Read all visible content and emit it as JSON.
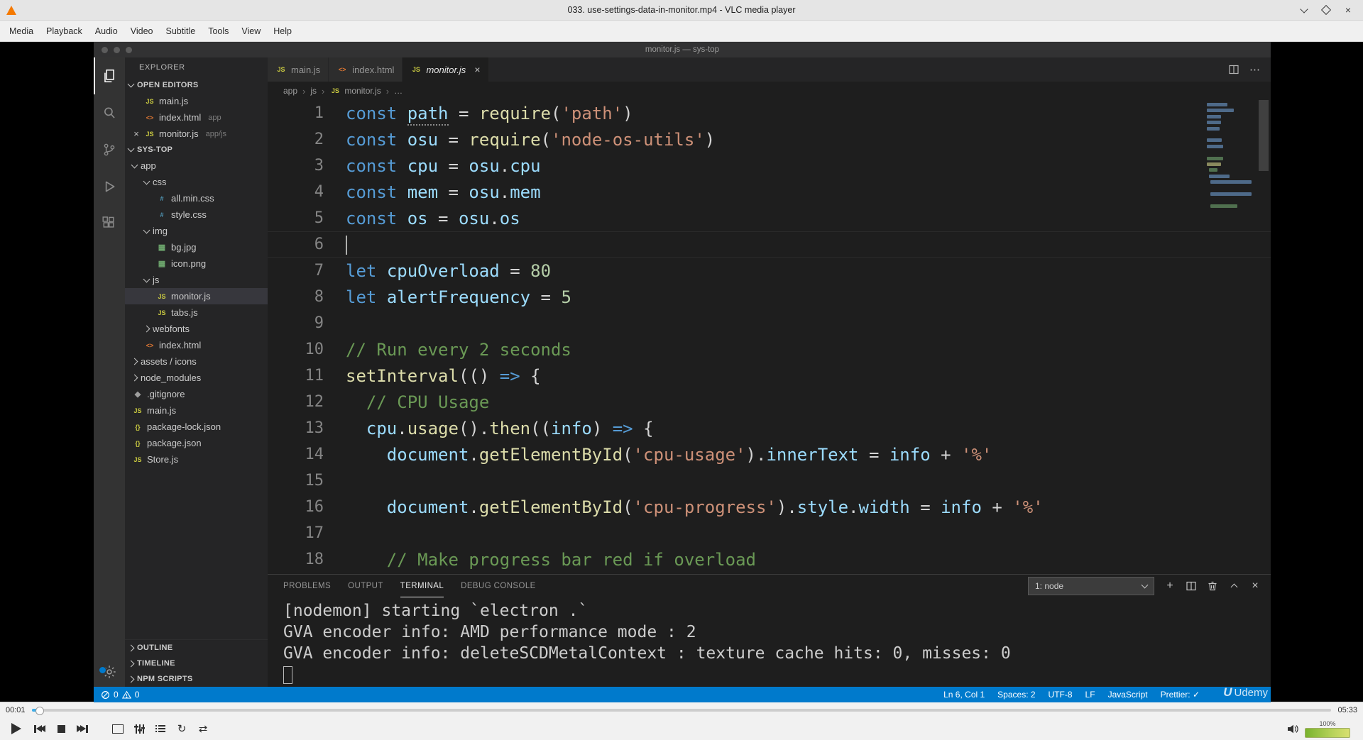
{
  "vlc": {
    "titlebar": {
      "title": "033. use-settings-data-in-monitor.mp4 - VLC media player",
      "buttons": [
        "minimize",
        "maximize",
        "close"
      ]
    },
    "menu": [
      "Media",
      "Playback",
      "Audio",
      "Video",
      "Subtitle",
      "Tools",
      "View",
      "Help"
    ],
    "seek": {
      "elapsed": "00:01",
      "duration": "05:33",
      "progress_percent": 0.4
    },
    "volume": {
      "level_label": "100%"
    }
  },
  "recording": {
    "window_title": "monitor.js — sys-top"
  },
  "vscode": {
    "activity_bar": {
      "items": [
        "explorer",
        "search",
        "source-control",
        "run-and-debug",
        "extensions"
      ],
      "active": "explorer",
      "bottom": "manage"
    },
    "file_icons": {
      "js": {
        "glyph": "JS",
        "color": "#cbcb41"
      },
      "html": {
        "glyph": "<>",
        "color": "#e37933"
      },
      "css": {
        "glyph": "#",
        "color": "#519aba"
      },
      "img": {
        "glyph": "▦",
        "color": "#6ea86e"
      },
      "json": {
        "glyph": "{}",
        "color": "#cbcb41"
      },
      "git": {
        "glyph": "◆",
        "color": "#9e9e9e"
      }
    },
    "explorer": {
      "header": "EXPLORER",
      "open_editors": {
        "label": "OPEN EDITORS",
        "items": [
          {
            "name": "main.js",
            "icon": "js"
          },
          {
            "name": "index.html",
            "icon": "html",
            "hint": "app"
          },
          {
            "name": "monitor.js",
            "icon": "js",
            "hint": "app/js",
            "close": true
          }
        ]
      },
      "project": {
        "label": "SYS-TOP",
        "items": [
          {
            "name": "app",
            "depth": 0,
            "folder": true,
            "expanded": true
          },
          {
            "name": "css",
            "depth": 1,
            "folder": true,
            "expanded": true
          },
          {
            "name": "all.min.css",
            "depth": 2,
            "icon": "css"
          },
          {
            "name": "style.css",
            "depth": 2,
            "icon": "css"
          },
          {
            "name": "img",
            "depth": 1,
            "folder": true,
            "expanded": true
          },
          {
            "name": "bg.jpg",
            "depth": 2,
            "icon": "img"
          },
          {
            "name": "icon.png",
            "depth": 2,
            "icon": "img"
          },
          {
            "name": "js",
            "depth": 1,
            "folder": true,
            "expanded": true
          },
          {
            "name": "monitor.js",
            "depth": 2,
            "icon": "js",
            "selected": true
          },
          {
            "name": "tabs.js",
            "depth": 2,
            "icon": "js"
          },
          {
            "name": "webfonts",
            "depth": 1,
            "folder": true,
            "expanded": false
          },
          {
            "name": "index.html",
            "depth": 1,
            "icon": "html"
          },
          {
            "name": "assets / icons",
            "depth": 0,
            "folder": true,
            "expanded": false
          },
          {
            "name": "node_modules",
            "depth": 0,
            "folder": true,
            "expanded": false
          },
          {
            "name": ".gitignore",
            "depth": 0,
            "icon": "git"
          },
          {
            "name": "main.js",
            "depth": 0,
            "icon": "js"
          },
          {
            "name": "package-lock.json",
            "depth": 0,
            "icon": "json"
          },
          {
            "name": "package.json",
            "depth": 0,
            "icon": "json"
          },
          {
            "name": "Store.js",
            "depth": 0,
            "icon": "js"
          }
        ]
      },
      "bottom_sections": [
        "OUTLINE",
        "TIMELINE",
        "NPM SCRIPTS"
      ]
    },
    "tabs": [
      {
        "label": "main.js",
        "icon": "js"
      },
      {
        "label": "index.html",
        "icon": "html"
      },
      {
        "label": "monitor.js",
        "icon": "js",
        "active": true
      }
    ],
    "breadcrumb": [
      {
        "label": "app"
      },
      {
        "label": "js"
      },
      {
        "label": "monitor.js",
        "icon": "js"
      },
      {
        "label": "…"
      }
    ],
    "code": {
      "lines": [
        {
          "n": 1,
          "tokens": [
            [
              "k",
              "const"
            ],
            [
              "d",
              " "
            ],
            [
              "v dots",
              "path"
            ],
            [
              "d",
              " = "
            ],
            [
              "f",
              "require"
            ],
            [
              "d",
              "("
            ],
            [
              "s",
              "'path'"
            ],
            [
              "d",
              ")"
            ]
          ]
        },
        {
          "n": 2,
          "tokens": [
            [
              "k",
              "const"
            ],
            [
              "d",
              " "
            ],
            [
              "v",
              "osu"
            ],
            [
              "d",
              " = "
            ],
            [
              "f",
              "require"
            ],
            [
              "d",
              "("
            ],
            [
              "s",
              "'node-os-utils'"
            ],
            [
              "d",
              ")"
            ]
          ]
        },
        {
          "n": 3,
          "tokens": [
            [
              "k",
              "const"
            ],
            [
              "d",
              " "
            ],
            [
              "v",
              "cpu"
            ],
            [
              "d",
              " = "
            ],
            [
              "v",
              "osu"
            ],
            [
              "d",
              "."
            ],
            [
              "v",
              "cpu"
            ]
          ]
        },
        {
          "n": 4,
          "tokens": [
            [
              "k",
              "const"
            ],
            [
              "d",
              " "
            ],
            [
              "v",
              "mem"
            ],
            [
              "d",
              " = "
            ],
            [
              "v",
              "osu"
            ],
            [
              "d",
              "."
            ],
            [
              "v",
              "mem"
            ]
          ]
        },
        {
          "n": 5,
          "tokens": [
            [
              "k",
              "const"
            ],
            [
              "d",
              " "
            ],
            [
              "v",
              "os"
            ],
            [
              "d",
              " = "
            ],
            [
              "v",
              "osu"
            ],
            [
              "d",
              "."
            ],
            [
              "v",
              "os"
            ]
          ]
        },
        {
          "n": 6,
          "tokens": [],
          "current": true
        },
        {
          "n": 7,
          "tokens": [
            [
              "k",
              "let"
            ],
            [
              "d",
              " "
            ],
            [
              "v",
              "cpuOverload"
            ],
            [
              "d",
              " = "
            ],
            [
              "n",
              "80"
            ]
          ]
        },
        {
          "n": 8,
          "tokens": [
            [
              "k",
              "let"
            ],
            [
              "d",
              " "
            ],
            [
              "v",
              "alertFrequency"
            ],
            [
              "d",
              " = "
            ],
            [
              "n",
              "5"
            ]
          ]
        },
        {
          "n": 9,
          "tokens": []
        },
        {
          "n": 10,
          "tokens": [
            [
              "c",
              "// Run every 2 seconds"
            ]
          ]
        },
        {
          "n": 11,
          "tokens": [
            [
              "f",
              "setInterval"
            ],
            [
              "d",
              "(() "
            ],
            [
              "a",
              "=>"
            ],
            [
              "d",
              " {"
            ]
          ]
        },
        {
          "n": 12,
          "tokens": [
            [
              "c",
              "  // CPU Usage"
            ]
          ]
        },
        {
          "n": 13,
          "tokens": [
            [
              "d",
              "  "
            ],
            [
              "v",
              "cpu"
            ],
            [
              "d",
              "."
            ],
            [
              "f",
              "usage"
            ],
            [
              "d",
              "()."
            ],
            [
              "f",
              "then"
            ],
            [
              "d",
              "(("
            ],
            [
              "v",
              "info"
            ],
            [
              "d",
              ") "
            ],
            [
              "a",
              "=>"
            ],
            [
              "d",
              " {"
            ]
          ]
        },
        {
          "n": 14,
          "tokens": [
            [
              "d",
              "    "
            ],
            [
              "v",
              "document"
            ],
            [
              "d",
              "."
            ],
            [
              "f",
              "getElementById"
            ],
            [
              "d",
              "("
            ],
            [
              "s",
              "'cpu-usage'"
            ],
            [
              "d",
              ")."
            ],
            [
              "v",
              "innerText"
            ],
            [
              "d",
              " = "
            ],
            [
              "v",
              "info"
            ],
            [
              "d",
              " + "
            ],
            [
              "s",
              "'%'"
            ]
          ]
        },
        {
          "n": 15,
          "tokens": []
        },
        {
          "n": 16,
          "tokens": [
            [
              "d",
              "    "
            ],
            [
              "v",
              "document"
            ],
            [
              "d",
              "."
            ],
            [
              "f",
              "getElementById"
            ],
            [
              "d",
              "("
            ],
            [
              "s",
              "'cpu-progress'"
            ],
            [
              "d",
              ")."
            ],
            [
              "v",
              "style"
            ],
            [
              "d",
              "."
            ],
            [
              "v",
              "width"
            ],
            [
              "d",
              " = "
            ],
            [
              "v",
              "info"
            ],
            [
              "d",
              " + "
            ],
            [
              "s",
              "'%'"
            ]
          ]
        },
        {
          "n": 17,
          "tokens": []
        },
        {
          "n": 18,
          "tokens": [
            [
              "c",
              "    // Make progress bar red if overload"
            ]
          ]
        }
      ]
    },
    "panel": {
      "tabs": [
        "PROBLEMS",
        "OUTPUT",
        "TERMINAL",
        "DEBUG CONSOLE"
      ],
      "active_tab": "TERMINAL",
      "shell_selector": "1: node",
      "terminal_lines": [
        "[nodemon] starting `electron .`",
        "GVA encoder info: AMD performance mode : 2",
        "GVA encoder info: deleteSCDMetalContext : texture cache hits: 0, misses: 0"
      ]
    },
    "status_bar": {
      "errors": "0",
      "warnings": "0",
      "items": [
        "Ln 6, Col 1",
        "Spaces: 2",
        "UTF-8",
        "LF",
        "JavaScript",
        "Prettier: ✓"
      ]
    }
  },
  "watermark": {
    "logo": "U",
    "text": "Udemy"
  }
}
